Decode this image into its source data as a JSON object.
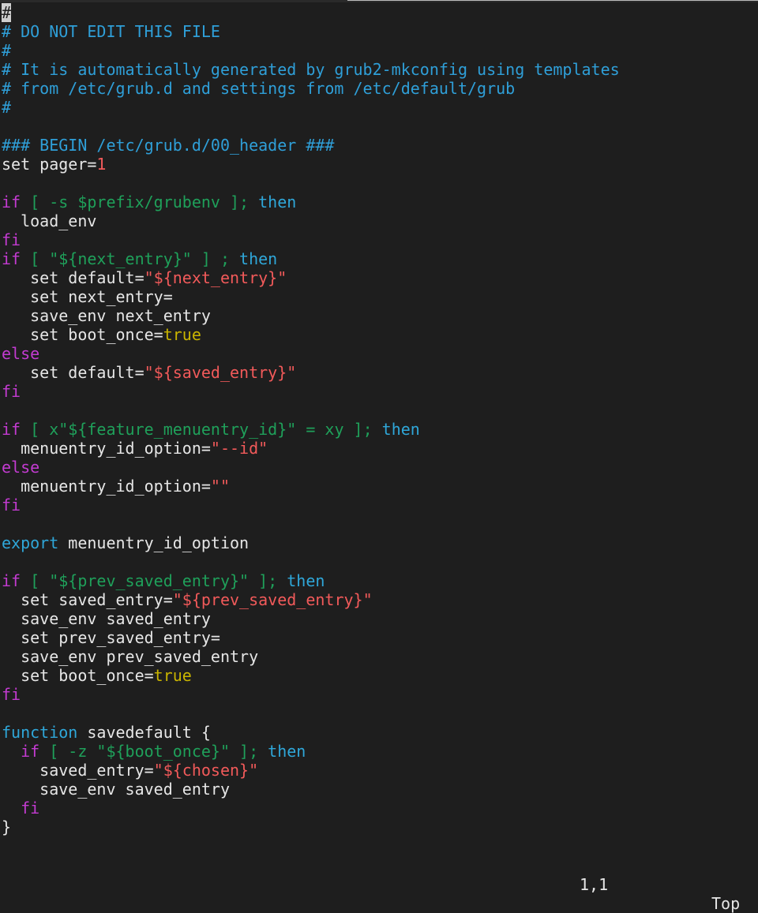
{
  "editor": {
    "colors": {
      "background": "#1e1e1e",
      "text": "#e6e6e6",
      "comment": "#2f9fd8",
      "keyword": "#2fa7d9",
      "conditional": "#c33bd1",
      "variable": "#1fa05a",
      "string": "#f25a5a",
      "number": "#f25a5a",
      "boolean": "#c9b400"
    },
    "lines": [
      [
        {
          "t": "#",
          "c": "cursor"
        }
      ],
      [
        {
          "t": "# DO NOT EDIT THIS FILE",
          "c": "comment"
        }
      ],
      [
        {
          "t": "#",
          "c": "comment"
        }
      ],
      [
        {
          "t": "# It is automatically generated by grub2-mkconfig using templates",
          "c": "comment"
        }
      ],
      [
        {
          "t": "# from /etc/grub.d and settings from /etc/default/grub",
          "c": "comment"
        }
      ],
      [
        {
          "t": "#",
          "c": "comment"
        }
      ],
      [],
      [
        {
          "t": "### BEGIN /etc/grub.d/00_header ###",
          "c": "comment"
        }
      ],
      [
        {
          "t": "set pager=",
          "c": "plain"
        },
        {
          "t": "1",
          "c": "number"
        }
      ],
      [],
      [
        {
          "t": "if",
          "c": "conditional"
        },
        {
          "t": " [ -s $prefix/grubenv ]; ",
          "c": "variable"
        },
        {
          "t": "then",
          "c": "keyword"
        }
      ],
      [
        {
          "t": "  load_env",
          "c": "plain"
        }
      ],
      [
        {
          "t": "fi",
          "c": "conditional"
        }
      ],
      [
        {
          "t": "if",
          "c": "conditional"
        },
        {
          "t": " [ \"${next_entry}\" ] ; ",
          "c": "variable"
        },
        {
          "t": "then",
          "c": "keyword"
        }
      ],
      [
        {
          "t": "   set default=",
          "c": "plain"
        },
        {
          "t": "\"${next_entry}\"",
          "c": "string"
        }
      ],
      [
        {
          "t": "   set next_entry=",
          "c": "plain"
        }
      ],
      [
        {
          "t": "   save_env next_entry",
          "c": "plain"
        }
      ],
      [
        {
          "t": "   set boot_once=",
          "c": "plain"
        },
        {
          "t": "true",
          "c": "boolean"
        }
      ],
      [
        {
          "t": "else",
          "c": "conditional"
        }
      ],
      [
        {
          "t": "   set default=",
          "c": "plain"
        },
        {
          "t": "\"${saved_entry}\"",
          "c": "string"
        }
      ],
      [
        {
          "t": "fi",
          "c": "conditional"
        }
      ],
      [],
      [
        {
          "t": "if",
          "c": "conditional"
        },
        {
          "t": " [ x\"${feature_menuentry_id}\" = xy ]; ",
          "c": "variable"
        },
        {
          "t": "then",
          "c": "keyword"
        }
      ],
      [
        {
          "t": "  menuentry_id_option=",
          "c": "plain"
        },
        {
          "t": "\"--id\"",
          "c": "string"
        }
      ],
      [
        {
          "t": "else",
          "c": "conditional"
        }
      ],
      [
        {
          "t": "  menuentry_id_option=",
          "c": "plain"
        },
        {
          "t": "\"\"",
          "c": "string"
        }
      ],
      [
        {
          "t": "fi",
          "c": "conditional"
        }
      ],
      [],
      [
        {
          "t": "export",
          "c": "keyword"
        },
        {
          "t": " menuentry_id_option",
          "c": "plain"
        }
      ],
      [],
      [
        {
          "t": "if",
          "c": "conditional"
        },
        {
          "t": " [ \"${prev_saved_entry}\" ]; ",
          "c": "variable"
        },
        {
          "t": "then",
          "c": "keyword"
        }
      ],
      [
        {
          "t": "  set saved_entry=",
          "c": "plain"
        },
        {
          "t": "\"${prev_saved_entry}\"",
          "c": "string"
        }
      ],
      [
        {
          "t": "  save_env saved_entry",
          "c": "plain"
        }
      ],
      [
        {
          "t": "  set prev_saved_entry=",
          "c": "plain"
        }
      ],
      [
        {
          "t": "  save_env prev_saved_entry",
          "c": "plain"
        }
      ],
      [
        {
          "t": "  set boot_once=",
          "c": "plain"
        },
        {
          "t": "true",
          "c": "boolean"
        }
      ],
      [
        {
          "t": "fi",
          "c": "conditional"
        }
      ],
      [],
      [
        {
          "t": "function",
          "c": "keyword"
        },
        {
          "t": " savedefault {",
          "c": "plain"
        }
      ],
      [
        {
          "t": "  ",
          "c": "plain"
        },
        {
          "t": "if",
          "c": "conditional"
        },
        {
          "t": " [ -z \"${boot_once}\" ]; ",
          "c": "variable"
        },
        {
          "t": "then",
          "c": "keyword"
        }
      ],
      [
        {
          "t": "    saved_entry=",
          "c": "plain"
        },
        {
          "t": "\"${chosen}\"",
          "c": "string"
        }
      ],
      [
        {
          "t": "    save_env saved_entry",
          "c": "plain"
        }
      ],
      [
        {
          "t": "  ",
          "c": "plain"
        },
        {
          "t": "fi",
          "c": "conditional"
        }
      ],
      [
        {
          "t": "}",
          "c": "plain"
        }
      ]
    ]
  },
  "status": {
    "position": "1,1",
    "scroll": "Top"
  }
}
